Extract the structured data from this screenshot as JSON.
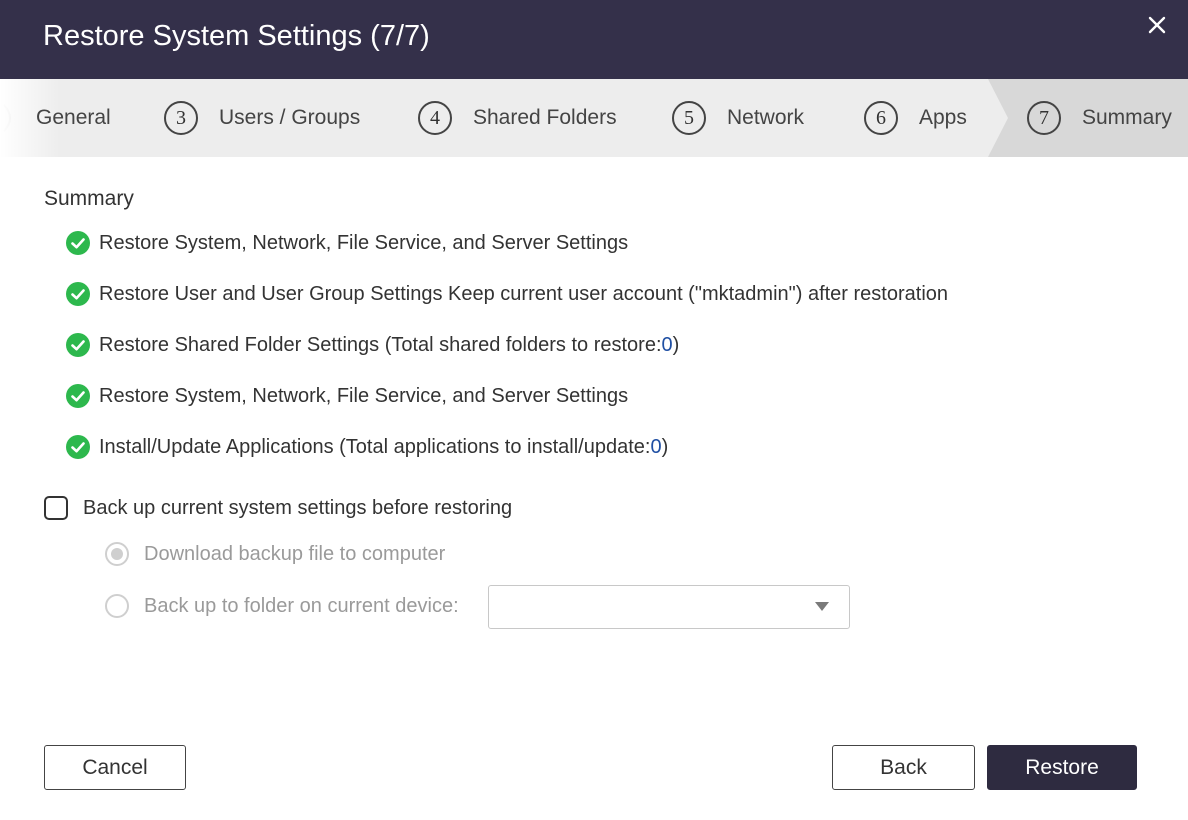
{
  "dialog": {
    "title": "Restore System Settings (7/7)",
    "close_icon": "close-icon"
  },
  "steps": [
    {
      "number": "",
      "label": "General"
    },
    {
      "number": "3",
      "label": "Users / Groups"
    },
    {
      "number": "4",
      "label": "Shared Folders"
    },
    {
      "number": "5",
      "label": "Network"
    },
    {
      "number": "6",
      "label": "Apps"
    },
    {
      "number": "7",
      "label": "Summary",
      "active": true
    }
  ],
  "summary": {
    "title": "Summary",
    "items": [
      {
        "text": "Restore System, Network, File Service, and Server Settings",
        "icon": "check-circle-icon"
      },
      {
        "text": "Restore User and User Group Settings Keep current user account (\"mktadmin\") after restoration",
        "icon": "check-circle-icon"
      },
      {
        "prefix": "Restore Shared Folder Settings (Total shared folders to restore: ",
        "count": "0",
        "suffix": ")",
        "icon": "check-circle-icon"
      },
      {
        "text": "Restore System, Network, File Service, and Server Settings",
        "icon": "check-circle-icon"
      },
      {
        "prefix": "Install/Update Applications (Total applications to install/update: ",
        "count": "0",
        "suffix": ")",
        "icon": "check-circle-icon"
      }
    ]
  },
  "backup": {
    "checkbox_label": "Back up current system settings before restoring",
    "checked": false,
    "options": [
      {
        "label": "Download backup file to computer",
        "selected": true
      },
      {
        "label": "Back up to folder on current device:",
        "selected": false
      }
    ],
    "folder_select_value": ""
  },
  "buttons": {
    "cancel": "Cancel",
    "back": "Back",
    "restore": "Restore"
  },
  "colors": {
    "titlebar": "#34304a",
    "primary_button": "#2e2b40",
    "check_green": "#2db84d",
    "count_blue": "#1f4fa3"
  }
}
